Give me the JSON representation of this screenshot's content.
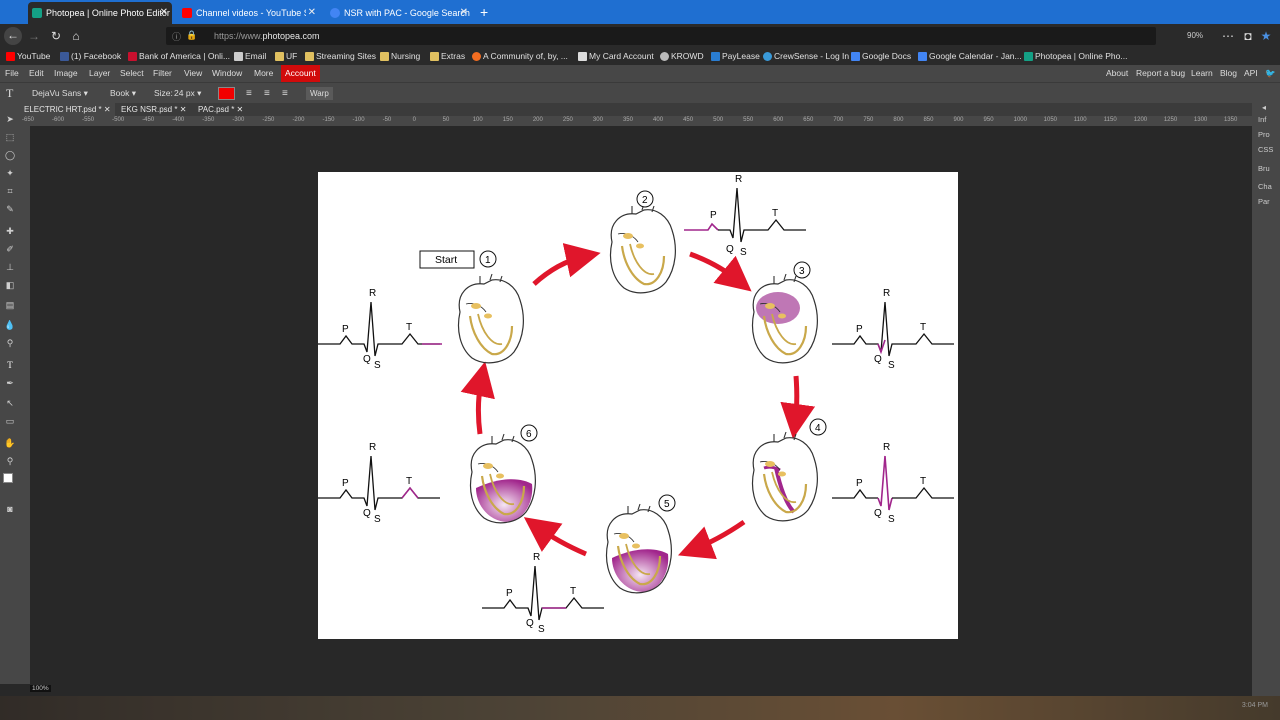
{
  "browser": {
    "tabs": [
      {
        "label": "Photopea | Online Photo Editor",
        "color": "#14a085",
        "active": true
      },
      {
        "label": "Channel videos - YouTube Studio",
        "color": "#ff0000",
        "active": false
      },
      {
        "label": "NSR with PAC - Google Search",
        "color": "#4285f4",
        "active": false
      }
    ],
    "url_prefix": "https://www.",
    "url_domain": "photopea.com",
    "zoom": "90%",
    "bookmarks": [
      {
        "label": "YouTube",
        "color": "#ff0000"
      },
      {
        "label": "(1) Facebook",
        "color": "#3b5998"
      },
      {
        "label": "Bank of America | Onli...",
        "color": "#c8102e"
      },
      {
        "label": "Email",
        "color": "#cccccc"
      },
      {
        "label": "UF",
        "color": "#e0c060"
      },
      {
        "label": "Streaming Sites",
        "color": "#e0c060"
      },
      {
        "label": "Nursing",
        "color": "#e0c060"
      },
      {
        "label": "Extras",
        "color": "#e0c060"
      },
      {
        "label": "A Community of, by, ...",
        "color": "#f36d21"
      },
      {
        "label": "My Card Account",
        "color": "#dddddd"
      },
      {
        "label": "KROWD",
        "color": "#bbbbbb"
      },
      {
        "label": "PayLease",
        "color": "#2a7dd1"
      },
      {
        "label": "CrewSense - Log In",
        "color": "#3a9ad9"
      },
      {
        "label": "Google Docs",
        "color": "#4285f4"
      },
      {
        "label": "Google Calendar - Jan...",
        "color": "#4285f4"
      },
      {
        "label": "Photopea | Online Pho...",
        "color": "#14a085"
      }
    ]
  },
  "menu": {
    "items": [
      "File",
      "Edit",
      "Image",
      "Layer",
      "Select",
      "Filter",
      "View",
      "Window",
      "More"
    ],
    "account": "Account",
    "right": [
      "About",
      "Report a bug",
      "Learn",
      "Blog",
      "API"
    ]
  },
  "options": {
    "font": "DejaVu Sans",
    "style": "Book",
    "size_label": "Size:",
    "size_value": "24 px",
    "text_color": "#f20000",
    "warp": "Warp"
  },
  "documents": [
    {
      "label": "ELECTRIC HRT.psd *",
      "active": true
    },
    {
      "label": "EKG NSR.psd *",
      "active": false
    },
    {
      "label": "PAC.psd *",
      "active": false
    }
  ],
  "ruler_labels": [
    "-650",
    "-600",
    "-550",
    "-500",
    "-450",
    "-400",
    "-350",
    "-300",
    "-250",
    "-200",
    "-150",
    "-100",
    "-50",
    "0",
    "50",
    "100",
    "150",
    "200",
    "250",
    "300",
    "350",
    "400",
    "450",
    "500",
    "550",
    "600",
    "650",
    "700",
    "750",
    "800",
    "850",
    "900",
    "950",
    "1000",
    "1050",
    "1100",
    "1150",
    "1200",
    "1250",
    "1300",
    "1350"
  ],
  "right_panels": [
    "Inf",
    "Pro",
    "CSS",
    "Bru",
    "Cha",
    "Par"
  ],
  "status": {
    "zoom": "100%"
  },
  "taskbar": {
    "time": "3:04 PM"
  },
  "diagram": {
    "start_label": "Start",
    "steps": [
      "1",
      "2",
      "3",
      "4",
      "5",
      "6"
    ],
    "wave_labels": {
      "p": "P",
      "q": "Q",
      "r": "R",
      "s": "S",
      "t": "T"
    },
    "colors": {
      "arrow": "#e0162b",
      "active": "#a1268c",
      "heart_fill": "#b45fa8"
    }
  }
}
